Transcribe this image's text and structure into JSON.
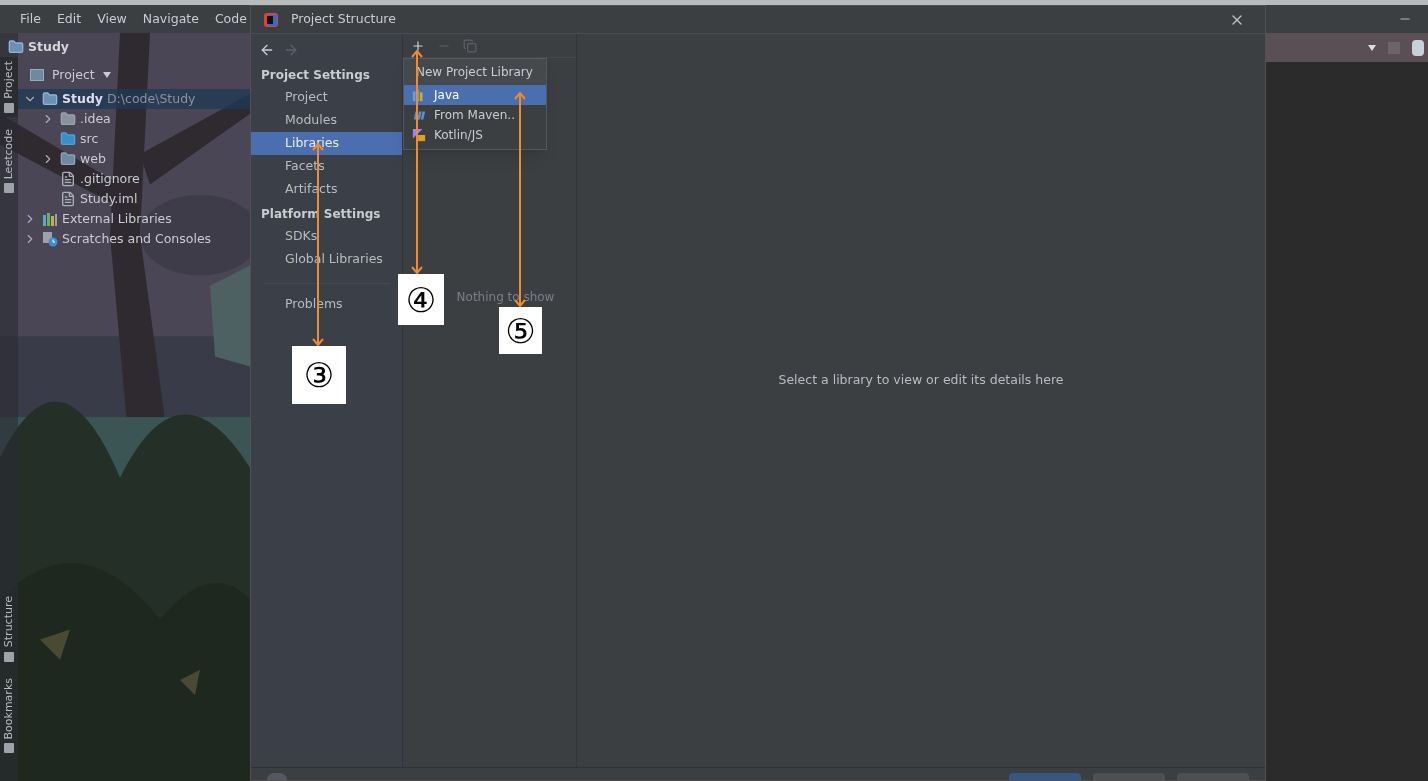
{
  "ide": {
    "menu": [
      {
        "label": "File"
      },
      {
        "label": "Edit"
      },
      {
        "label": "View"
      },
      {
        "label": "Navigate"
      },
      {
        "label": "Code"
      }
    ],
    "project_title": "Study",
    "view_selector": "Project",
    "side_tabs": [
      {
        "label": "Project",
        "selected": true
      },
      {
        "label": "Leetcode",
        "selected": false
      }
    ],
    "bottom_side_tabs": [
      {
        "label": "Structure"
      },
      {
        "label": "Bookmarks"
      }
    ],
    "tree": [
      {
        "label": "Study",
        "path": "D:\\code\\Study",
        "kind": "module",
        "expanded": true,
        "selected": true,
        "children": [
          {
            "label": ".idea",
            "kind": "folder",
            "expanded": false,
            "selected": false
          },
          {
            "label": "src",
            "kind": "source",
            "selected": false
          },
          {
            "label": "web",
            "kind": "webfolder",
            "expanded": false,
            "selected": false
          },
          {
            "label": ".gitignore",
            "kind": "file",
            "selected": false
          },
          {
            "label": "Study.iml",
            "kind": "file",
            "selected": false
          }
        ]
      },
      {
        "label": "External Libraries",
        "kind": "libraries",
        "expanded": false,
        "selected": false
      },
      {
        "label": "Scratches and Consoles",
        "kind": "scratches",
        "expanded": false,
        "selected": false
      }
    ]
  },
  "dialog": {
    "title": "Project Structure",
    "nav_sections": [
      {
        "heading": "Project Settings",
        "items": [
          {
            "label": "Project",
            "selected": false
          },
          {
            "label": "Modules",
            "selected": false
          },
          {
            "label": "Libraries",
            "selected": true
          },
          {
            "label": "Facets",
            "selected": false
          },
          {
            "label": "Artifacts",
            "selected": false
          }
        ]
      },
      {
        "heading": "Platform Settings",
        "items": [
          {
            "label": "SDKs",
            "selected": false
          },
          {
            "label": "Global Libraries",
            "selected": false
          }
        ]
      }
    ],
    "problems": "Problems",
    "empty_list": "Nothing to show",
    "detail_hint": "Select a library to view or edit its details here",
    "popup": {
      "title": "New Project Library",
      "items": [
        {
          "label": "Java",
          "kind": "java",
          "selected": true
        },
        {
          "label": "From Maven..",
          "kind": "maven",
          "selected": false
        },
        {
          "label": "Kotlin/JS",
          "kind": "kotlin",
          "selected": false
        }
      ]
    }
  },
  "annotations": [
    {
      "label": "③"
    },
    {
      "label": "④"
    },
    {
      "label": "⑤"
    }
  ]
}
